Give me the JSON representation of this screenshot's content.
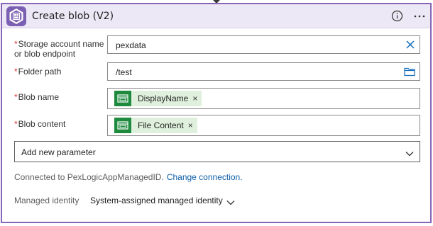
{
  "header": {
    "title": "Create blob (V2)",
    "icons": {
      "app": "blob-storage-icon",
      "info": "info-icon",
      "more": "more-options-icon"
    },
    "accent_color": "#8764b8"
  },
  "fields": [
    {
      "label_line1": "Storage account name",
      "label_line2": "or blob endpoint",
      "value": "pexdata",
      "action_icon": "clear-icon"
    },
    {
      "label": "Folder path",
      "value": "/test",
      "action_icon": "folder-icon"
    },
    {
      "label": "Blob name",
      "token": "DisplayName"
    },
    {
      "label": "Blob content",
      "token": "File Content"
    }
  ],
  "required_marker": "*",
  "token_close": "×",
  "add_parameter": {
    "placeholder": "Add new parameter"
  },
  "connection": {
    "text": "Connected to PexLogicAppManagedID.",
    "link": "Change connection."
  },
  "managed_identity": {
    "label": "Managed identity",
    "value": "System-assigned managed identity"
  }
}
